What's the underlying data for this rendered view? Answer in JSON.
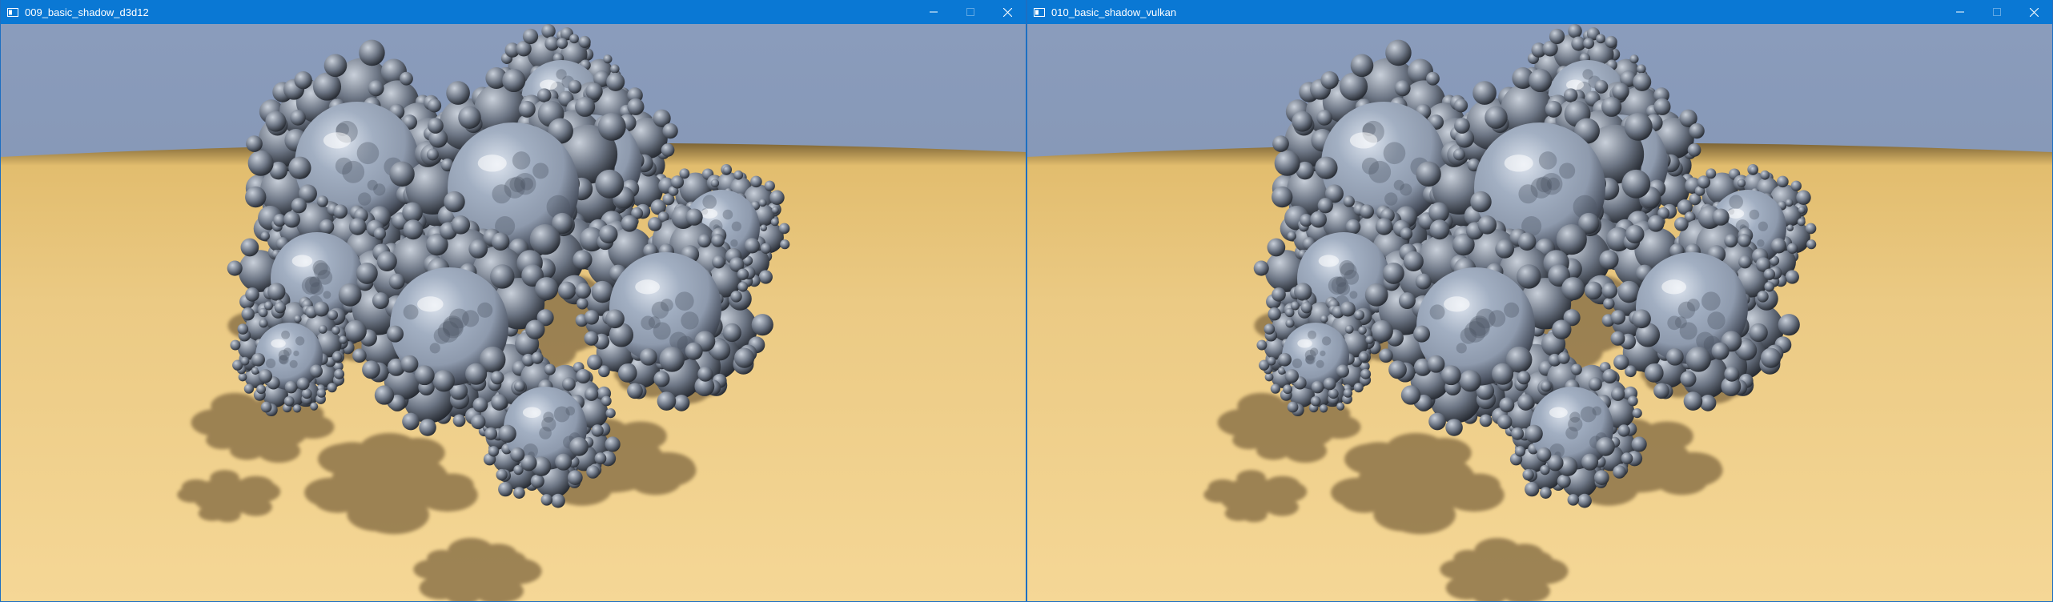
{
  "windows": [
    {
      "title": "009_basic_shadow_d3d12",
      "icon": "window-app-icon",
      "controls": [
        "minimize-icon",
        "maximize-icon",
        "close-icon"
      ],
      "maximize_enabled": false,
      "content": "rendered fractal sphere scene with shadows"
    },
    {
      "title": "010_basic_shadow_vulkan",
      "icon": "window-app-icon",
      "controls": [
        "minimize-icon",
        "maximize-icon",
        "close-icon"
      ],
      "maximize_enabled": false,
      "content": "rendered fractal sphere scene with shadows"
    }
  ],
  "colors": {
    "titlebar": "#0a78d4",
    "sky_top": "#8a9cbc",
    "sky_horizon": "#7d8da8",
    "floor_near": "#f5d796",
    "floor_far": "#e2bd6e",
    "sphere_chrome": "#8e9aad",
    "shadow": "#8e7548"
  }
}
